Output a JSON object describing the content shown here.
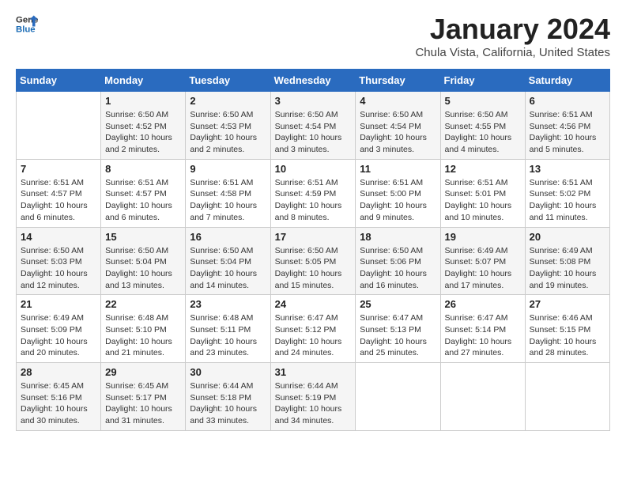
{
  "logo": {
    "general": "General",
    "blue": "Blue"
  },
  "title": "January 2024",
  "subtitle": "Chula Vista, California, United States",
  "days_of_week": [
    "Sunday",
    "Monday",
    "Tuesday",
    "Wednesday",
    "Thursday",
    "Friday",
    "Saturday"
  ],
  "weeks": [
    [
      {
        "day": "",
        "info": ""
      },
      {
        "day": "1",
        "info": "Sunrise: 6:50 AM\nSunset: 4:52 PM\nDaylight: 10 hours\nand 2 minutes."
      },
      {
        "day": "2",
        "info": "Sunrise: 6:50 AM\nSunset: 4:53 PM\nDaylight: 10 hours\nand 2 minutes."
      },
      {
        "day": "3",
        "info": "Sunrise: 6:50 AM\nSunset: 4:54 PM\nDaylight: 10 hours\nand 3 minutes."
      },
      {
        "day": "4",
        "info": "Sunrise: 6:50 AM\nSunset: 4:54 PM\nDaylight: 10 hours\nand 3 minutes."
      },
      {
        "day": "5",
        "info": "Sunrise: 6:50 AM\nSunset: 4:55 PM\nDaylight: 10 hours\nand 4 minutes."
      },
      {
        "day": "6",
        "info": "Sunrise: 6:51 AM\nSunset: 4:56 PM\nDaylight: 10 hours\nand 5 minutes."
      }
    ],
    [
      {
        "day": "7",
        "info": "Sunrise: 6:51 AM\nSunset: 4:57 PM\nDaylight: 10 hours\nand 6 minutes."
      },
      {
        "day": "8",
        "info": "Sunrise: 6:51 AM\nSunset: 4:57 PM\nDaylight: 10 hours\nand 6 minutes."
      },
      {
        "day": "9",
        "info": "Sunrise: 6:51 AM\nSunset: 4:58 PM\nDaylight: 10 hours\nand 7 minutes."
      },
      {
        "day": "10",
        "info": "Sunrise: 6:51 AM\nSunset: 4:59 PM\nDaylight: 10 hours\nand 8 minutes."
      },
      {
        "day": "11",
        "info": "Sunrise: 6:51 AM\nSunset: 5:00 PM\nDaylight: 10 hours\nand 9 minutes."
      },
      {
        "day": "12",
        "info": "Sunrise: 6:51 AM\nSunset: 5:01 PM\nDaylight: 10 hours\nand 10 minutes."
      },
      {
        "day": "13",
        "info": "Sunrise: 6:51 AM\nSunset: 5:02 PM\nDaylight: 10 hours\nand 11 minutes."
      }
    ],
    [
      {
        "day": "14",
        "info": "Sunrise: 6:50 AM\nSunset: 5:03 PM\nDaylight: 10 hours\nand 12 minutes."
      },
      {
        "day": "15",
        "info": "Sunrise: 6:50 AM\nSunset: 5:04 PM\nDaylight: 10 hours\nand 13 minutes."
      },
      {
        "day": "16",
        "info": "Sunrise: 6:50 AM\nSunset: 5:04 PM\nDaylight: 10 hours\nand 14 minutes."
      },
      {
        "day": "17",
        "info": "Sunrise: 6:50 AM\nSunset: 5:05 PM\nDaylight: 10 hours\nand 15 minutes."
      },
      {
        "day": "18",
        "info": "Sunrise: 6:50 AM\nSunset: 5:06 PM\nDaylight: 10 hours\nand 16 minutes."
      },
      {
        "day": "19",
        "info": "Sunrise: 6:49 AM\nSunset: 5:07 PM\nDaylight: 10 hours\nand 17 minutes."
      },
      {
        "day": "20",
        "info": "Sunrise: 6:49 AM\nSunset: 5:08 PM\nDaylight: 10 hours\nand 19 minutes."
      }
    ],
    [
      {
        "day": "21",
        "info": "Sunrise: 6:49 AM\nSunset: 5:09 PM\nDaylight: 10 hours\nand 20 minutes."
      },
      {
        "day": "22",
        "info": "Sunrise: 6:48 AM\nSunset: 5:10 PM\nDaylight: 10 hours\nand 21 minutes."
      },
      {
        "day": "23",
        "info": "Sunrise: 6:48 AM\nSunset: 5:11 PM\nDaylight: 10 hours\nand 23 minutes."
      },
      {
        "day": "24",
        "info": "Sunrise: 6:47 AM\nSunset: 5:12 PM\nDaylight: 10 hours\nand 24 minutes."
      },
      {
        "day": "25",
        "info": "Sunrise: 6:47 AM\nSunset: 5:13 PM\nDaylight: 10 hours\nand 25 minutes."
      },
      {
        "day": "26",
        "info": "Sunrise: 6:47 AM\nSunset: 5:14 PM\nDaylight: 10 hours\nand 27 minutes."
      },
      {
        "day": "27",
        "info": "Sunrise: 6:46 AM\nSunset: 5:15 PM\nDaylight: 10 hours\nand 28 minutes."
      }
    ],
    [
      {
        "day": "28",
        "info": "Sunrise: 6:45 AM\nSunset: 5:16 PM\nDaylight: 10 hours\nand 30 minutes."
      },
      {
        "day": "29",
        "info": "Sunrise: 6:45 AM\nSunset: 5:17 PM\nDaylight: 10 hours\nand 31 minutes."
      },
      {
        "day": "30",
        "info": "Sunrise: 6:44 AM\nSunset: 5:18 PM\nDaylight: 10 hours\nand 33 minutes."
      },
      {
        "day": "31",
        "info": "Sunrise: 6:44 AM\nSunset: 5:19 PM\nDaylight: 10 hours\nand 34 minutes."
      },
      {
        "day": "",
        "info": ""
      },
      {
        "day": "",
        "info": ""
      },
      {
        "day": "",
        "info": ""
      }
    ]
  ]
}
